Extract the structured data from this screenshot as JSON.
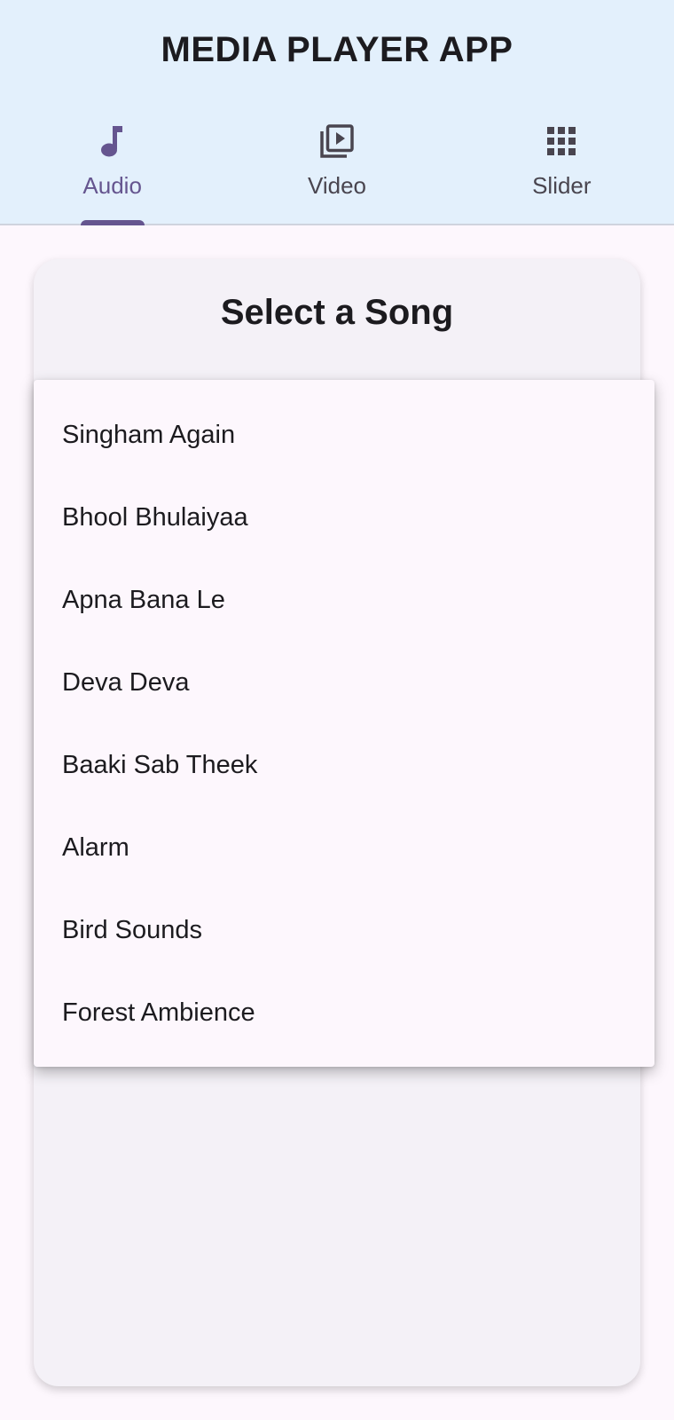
{
  "app": {
    "title": "MEDIA PLAYER APP",
    "accent_color": "#65558f",
    "header_bg": "#e3f0fc"
  },
  "tabs": [
    {
      "label": "Audio",
      "icon": "music-note-icon",
      "active": true
    },
    {
      "label": "Video",
      "icon": "video-library-icon",
      "active": false
    },
    {
      "label": "Slider",
      "icon": "grid-icon",
      "active": false
    }
  ],
  "card": {
    "title": "Select a Song"
  },
  "dropdown": {
    "options": [
      "Singham Again",
      "Bhool Bhulaiyaa",
      "Apna Bana Le",
      "Deva Deva",
      "Baaki Sab Theek",
      "Alarm",
      "Bird Sounds",
      "Forest Ambience"
    ]
  }
}
